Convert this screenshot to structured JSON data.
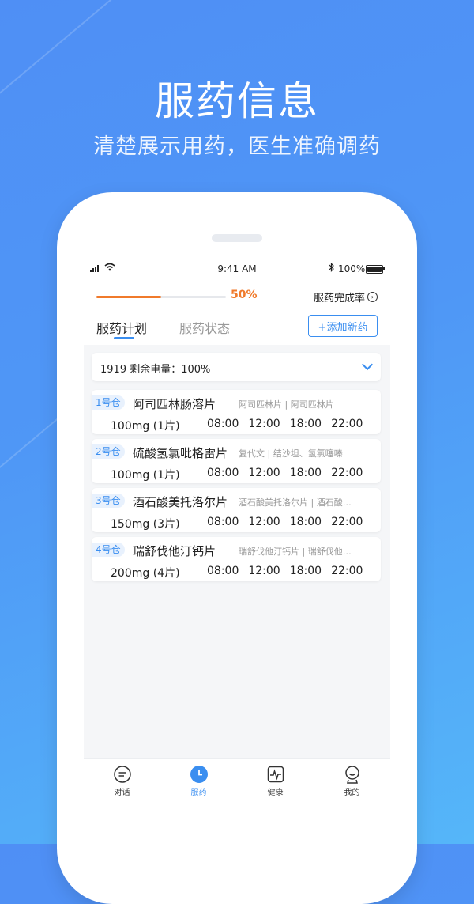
{
  "promo": {
    "title": "服药信息",
    "subtitle": "清楚展示用药，医生准确调药"
  },
  "status_bar": {
    "time": "9:41 AM",
    "battery": "100%"
  },
  "progress": {
    "value": 0.5,
    "label": "50%",
    "color": "#f07a2b"
  },
  "header": {
    "completion_link": "服药完成率",
    "tabs": [
      {
        "label": "服药计划",
        "active": true
      },
      {
        "label": "服药状态",
        "active": false
      }
    ],
    "add_button": "+添加新药"
  },
  "device": {
    "label": "1919  剩余电量：100%"
  },
  "medications": [
    {
      "slot": "1号仓",
      "name": "阿司匹林肠溶片",
      "alias": "阿司匹林片 | 阿司匹林片",
      "dose": "100mg (1片)",
      "times": [
        "08:00",
        "12:00",
        "18:00",
        "22:00"
      ]
    },
    {
      "slot": "2号仓",
      "name": "硫酸氢氯吡格雷片",
      "alias": "复代文 | 结沙坦、氢氯噻嗪",
      "dose": "100mg (1片)",
      "times": [
        "08:00",
        "12:00",
        "18:00",
        "22:00"
      ]
    },
    {
      "slot": "3号仓",
      "name": "酒石酸美托洛尔片",
      "alias": "酒石酸美托洛尔片 | 酒石酸…",
      "dose": "150mg (3片)",
      "times": [
        "08:00",
        "12:00",
        "18:00",
        "22:00"
      ]
    },
    {
      "slot": "4号仓",
      "name": "瑞舒伐他汀钙片",
      "alias": "瑞舒伐他汀钙片 | 瑞舒伐他…",
      "dose": "200mg (4片)",
      "times": [
        "08:00",
        "12:00",
        "18:00",
        "22:00"
      ]
    }
  ],
  "tabbar": [
    {
      "label": "对话",
      "icon": "chat-icon",
      "active": false
    },
    {
      "label": "服药",
      "icon": "clock-icon",
      "active": true
    },
    {
      "label": "健康",
      "icon": "pulse-icon",
      "active": false
    },
    {
      "label": "我的",
      "icon": "profile-icon",
      "active": false
    }
  ],
  "colors": {
    "accent": "#3a8ef0",
    "progress": "#f07a2b",
    "background_top": "#4f8ff5",
    "background_bottom": "#55b6f9"
  }
}
